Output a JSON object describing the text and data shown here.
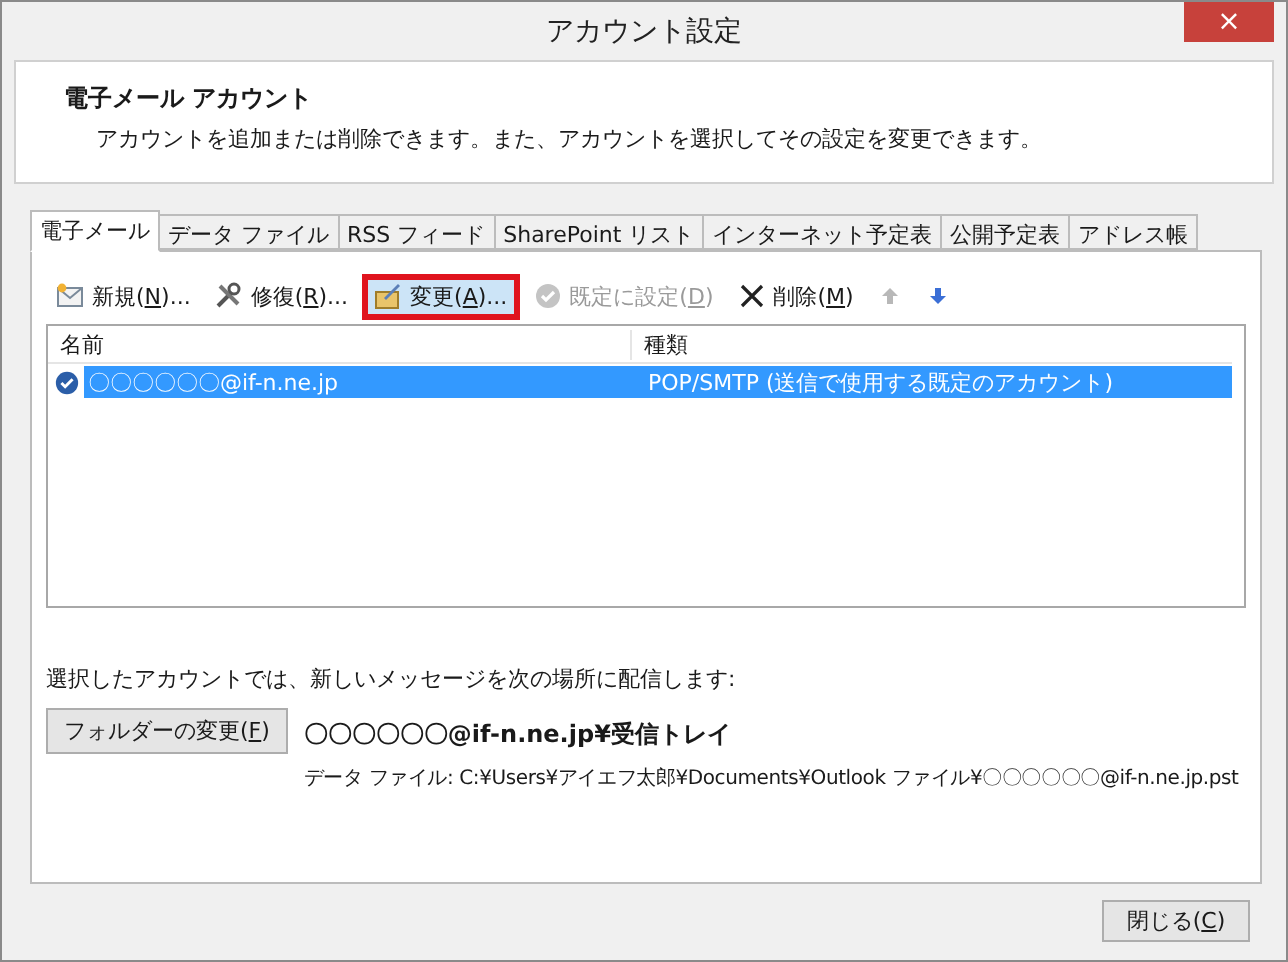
{
  "window": {
    "title": "アカウント設定",
    "close": "×"
  },
  "header": {
    "title": "電子メール アカウント",
    "description": "アカウントを追加または削除できます。また、アカウントを選択してその設定を変更できます。"
  },
  "tabs": [
    {
      "label": "電子メール",
      "selected": true
    },
    {
      "label": "データ ファイル",
      "selected": false
    },
    {
      "label": "RSS フィード",
      "selected": false
    },
    {
      "label": "SharePoint リスト",
      "selected": false
    },
    {
      "label": "インターネット予定表",
      "selected": false
    },
    {
      "label": "公開予定表",
      "selected": false
    },
    {
      "label": "アドレス帳",
      "selected": false
    }
  ],
  "toolbar": [
    {
      "kind": "new",
      "prefix": "新規(",
      "key": "N",
      "suffix": ")...",
      "disabled": false,
      "highlighted": false
    },
    {
      "kind": "repair",
      "prefix": "修復(",
      "key": "R",
      "suffix": ")...",
      "disabled": false,
      "highlighted": false
    },
    {
      "kind": "change",
      "prefix": "変更(",
      "key": "A",
      "suffix": ")...",
      "disabled": false,
      "highlighted": true
    },
    {
      "kind": "default",
      "prefix": "既定に設定(",
      "key": "D",
      "suffix": ")",
      "disabled": true,
      "highlighted": false
    },
    {
      "kind": "delete",
      "prefix": "削除(",
      "key": "M",
      "suffix": ")",
      "disabled": false,
      "highlighted": false
    },
    {
      "kind": "up",
      "disabled": true
    },
    {
      "kind": "down",
      "disabled": false
    }
  ],
  "table": {
    "columns": [
      "名前",
      "種類"
    ],
    "rows": [
      {
        "name": "〇〇〇〇〇〇@if-n.ne.jp",
        "type": "POP/SMTP (送信で使用する既定のアカウント)",
        "selected": true,
        "default": true
      }
    ]
  },
  "delivery": {
    "label": "選択したアカウントでは、新しいメッセージを次の場所に配信します:",
    "button": {
      "prefix": "フォルダーの変更(",
      "key": "F",
      "suffix": ")"
    },
    "location": "〇〇〇〇〇〇@if-n.ne.jp¥受信トレイ",
    "data_file": "データ ファイル: C:¥Users¥アイエフ太郎¥Documents¥Outlook ファイル¥〇〇〇〇〇〇@if-n.ne.jp.pst"
  },
  "footer": {
    "close": {
      "prefix": "閉じる(",
      "key": "C",
      "suffix": ")"
    }
  }
}
